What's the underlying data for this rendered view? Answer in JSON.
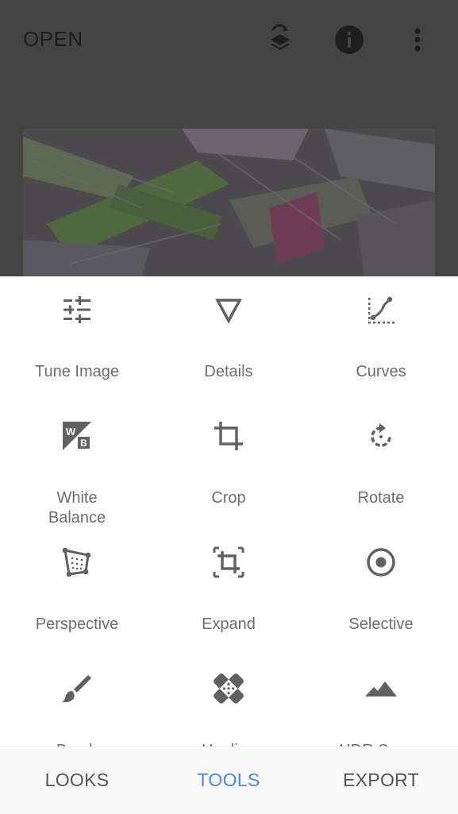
{
  "header": {
    "open_label": "OPEN",
    "icons": [
      "layers-swap-icon",
      "info-icon",
      "more-vert-icon"
    ]
  },
  "tools": [
    {
      "label": "Tune Image",
      "icon": "tune-icon"
    },
    {
      "label": "Details",
      "icon": "details-triangle-icon"
    },
    {
      "label": "Curves",
      "icon": "curves-icon"
    },
    {
      "label": "White Balance",
      "icon": "white-balance-icon"
    },
    {
      "label": "Crop",
      "icon": "crop-icon"
    },
    {
      "label": "Rotate",
      "icon": "rotate-icon"
    },
    {
      "label": "Perspective",
      "icon": "perspective-icon"
    },
    {
      "label": "Expand",
      "icon": "expand-icon"
    },
    {
      "label": "Selective",
      "icon": "selective-icon"
    },
    {
      "label": "Brush",
      "icon": "brush-icon"
    },
    {
      "label": "Healing",
      "icon": "healing-icon"
    },
    {
      "label": "HDR Scape",
      "icon": "mountain-icon"
    }
  ],
  "bottom_tabs": [
    {
      "label": "LOOKS",
      "active": false
    },
    {
      "label": "TOOLS",
      "active": true
    },
    {
      "label": "EXPORT",
      "active": false
    }
  ],
  "colors": {
    "accent": "#4a86e8",
    "icon": "#616161",
    "label": "#6d6d6d",
    "tab_inactive": "#555555",
    "overlay": "#444444"
  }
}
